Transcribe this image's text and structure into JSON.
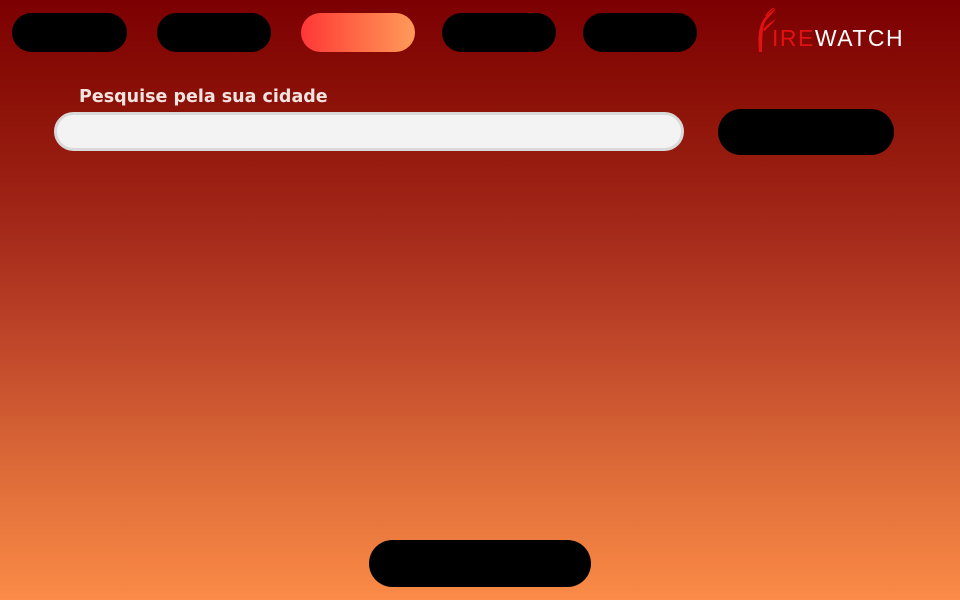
{
  "nav": {
    "items": [
      {
        "label": "",
        "active": false
      },
      {
        "label": "",
        "active": false
      },
      {
        "label": "",
        "active": true
      },
      {
        "label": "",
        "active": false
      },
      {
        "label": "",
        "active": false
      }
    ]
  },
  "logo": {
    "letter_f": "F",
    "text_ire": "IRE",
    "text_watch": "WATCH",
    "colors": {
      "accent": "#e31212",
      "text": "#ffffff"
    }
  },
  "search": {
    "label": "Pesquise pela sua cidade",
    "value": "",
    "placeholder": "",
    "button_label": ""
  },
  "footer": {
    "button_label": ""
  },
  "theme": {
    "background_top": "#7c0002",
    "background_bottom": "#fb8b47",
    "active_pill_start": "#ff3737",
    "active_pill_end": "#ff9a5a",
    "pill_color": "#000000"
  }
}
